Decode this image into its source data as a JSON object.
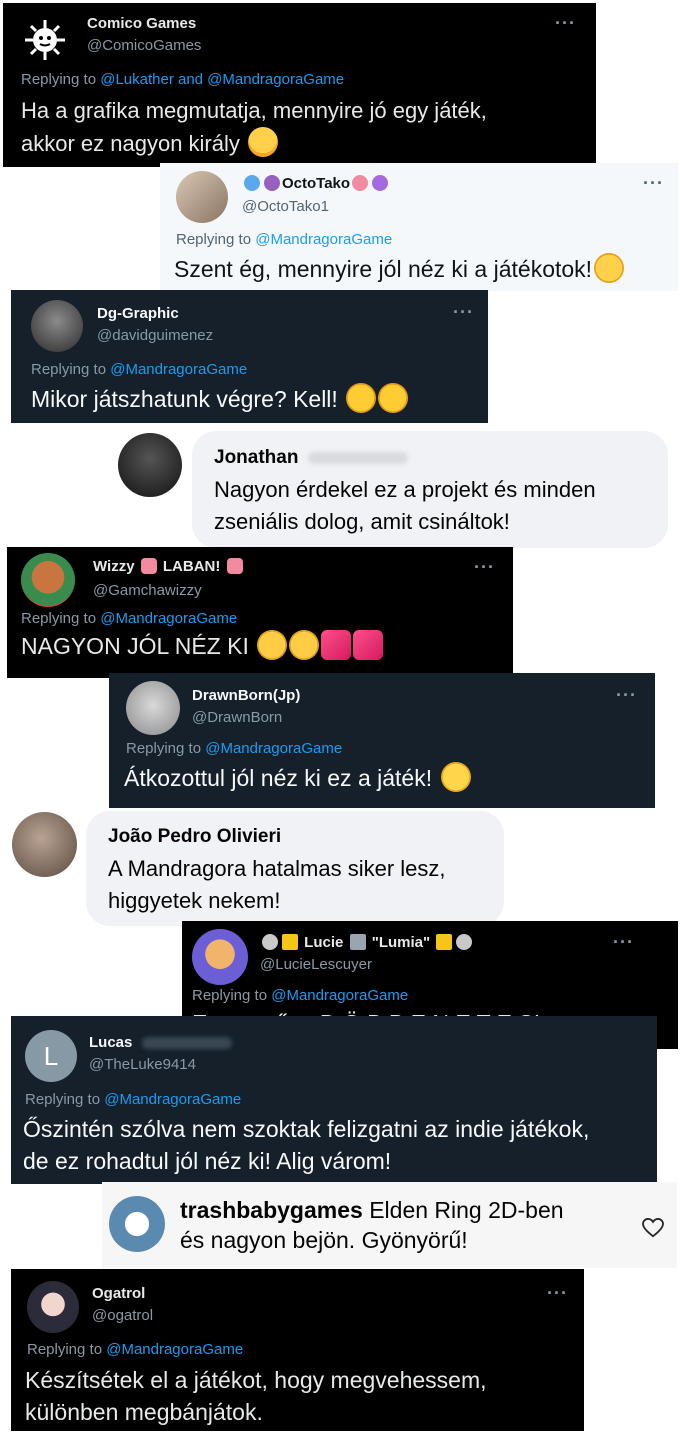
{
  "tweets": [
    {
      "name": "Comico Games",
      "handle": "@ComicoGames",
      "replying_prefix": "Replying to",
      "mentions": "@Lukather and @MandragoraGame",
      "text": "Ha a grafika megmutatja, mennyire jó egy játék,",
      "text2": "akkor ez nagyon király"
    },
    {
      "name": "OctoTako",
      "handle": "@OctoTako1",
      "replying_prefix": "Replying to",
      "mentions": "@MandragoraGame",
      "text": "Szent ég, mennyire jól néz ki a játékotok!"
    },
    {
      "name": "Dg-Graphic",
      "handle": "@davidguimenez",
      "replying_prefix": "Replying to",
      "mentions": "@MandragoraGame",
      "text": "Mikor játszhatunk végre? Kell!"
    },
    {
      "name": "Wizzy",
      "name2": "LABAN!",
      "handle": "@Gamchawizzy",
      "replying_prefix": "Replying to",
      "mentions": "@MandragoraGame",
      "text": "NAGYON JÓL NÉZ KI"
    },
    {
      "name": "DrawnBorn(Jp)",
      "handle": "@DrawnBorn",
      "replying_prefix": "Replying to",
      "mentions": "@MandragoraGame",
      "text": "Átkozottul jól néz ki ez a játék!"
    },
    {
      "name": "Lucie",
      "name2": "\"Lumia\"",
      "handle": "@LucieLescuyer",
      "replying_prefix": "Replying to",
      "mentions": "@MandragoraGame",
      "text": "Egyszerűen D Ö B B E N E T E S!"
    },
    {
      "name": "Lucas",
      "handle": "@TheLuke9414",
      "avatar_letter": "L",
      "replying_prefix": "Replying to",
      "mentions": "@MandragoraGame",
      "text": "Őszintén szólva nem szoktak felizgatni az indie játékok,",
      "text2": "de ez rohadtul jól néz ki! Alig várom!"
    },
    {
      "name": "Ogatrol",
      "handle": "@ogatrol",
      "replying_prefix": "Replying to",
      "mentions": "@MandragoraGame",
      "text": "Készítsétek el a játékot, hogy megvehessem,",
      "text2": "különben megbánjátok."
    }
  ],
  "fb_comments": [
    {
      "name": "Jonathan",
      "text": "Nagyon érdekel ez a projekt és minden",
      "text2": "zseniális dolog, amit csináltok!"
    },
    {
      "name": "João Pedro Olivieri",
      "text": "A Mandragora hatalmas siker lesz,",
      "text2": "higgyetek nekem!"
    }
  ],
  "insta_comment": {
    "name": "trashbabygames",
    "text": "Elden Ring 2D-ben",
    "text2": "és nagyon bejön. Gyönyörű!"
  },
  "more_glyph": "···",
  "colors": {
    "twitter_black": "#000000",
    "twitter_dim": "#15202b",
    "twitter_light": "#f5f8fa",
    "mention": "#1d9bf0",
    "fb_bubble": "#f0f2f5"
  }
}
